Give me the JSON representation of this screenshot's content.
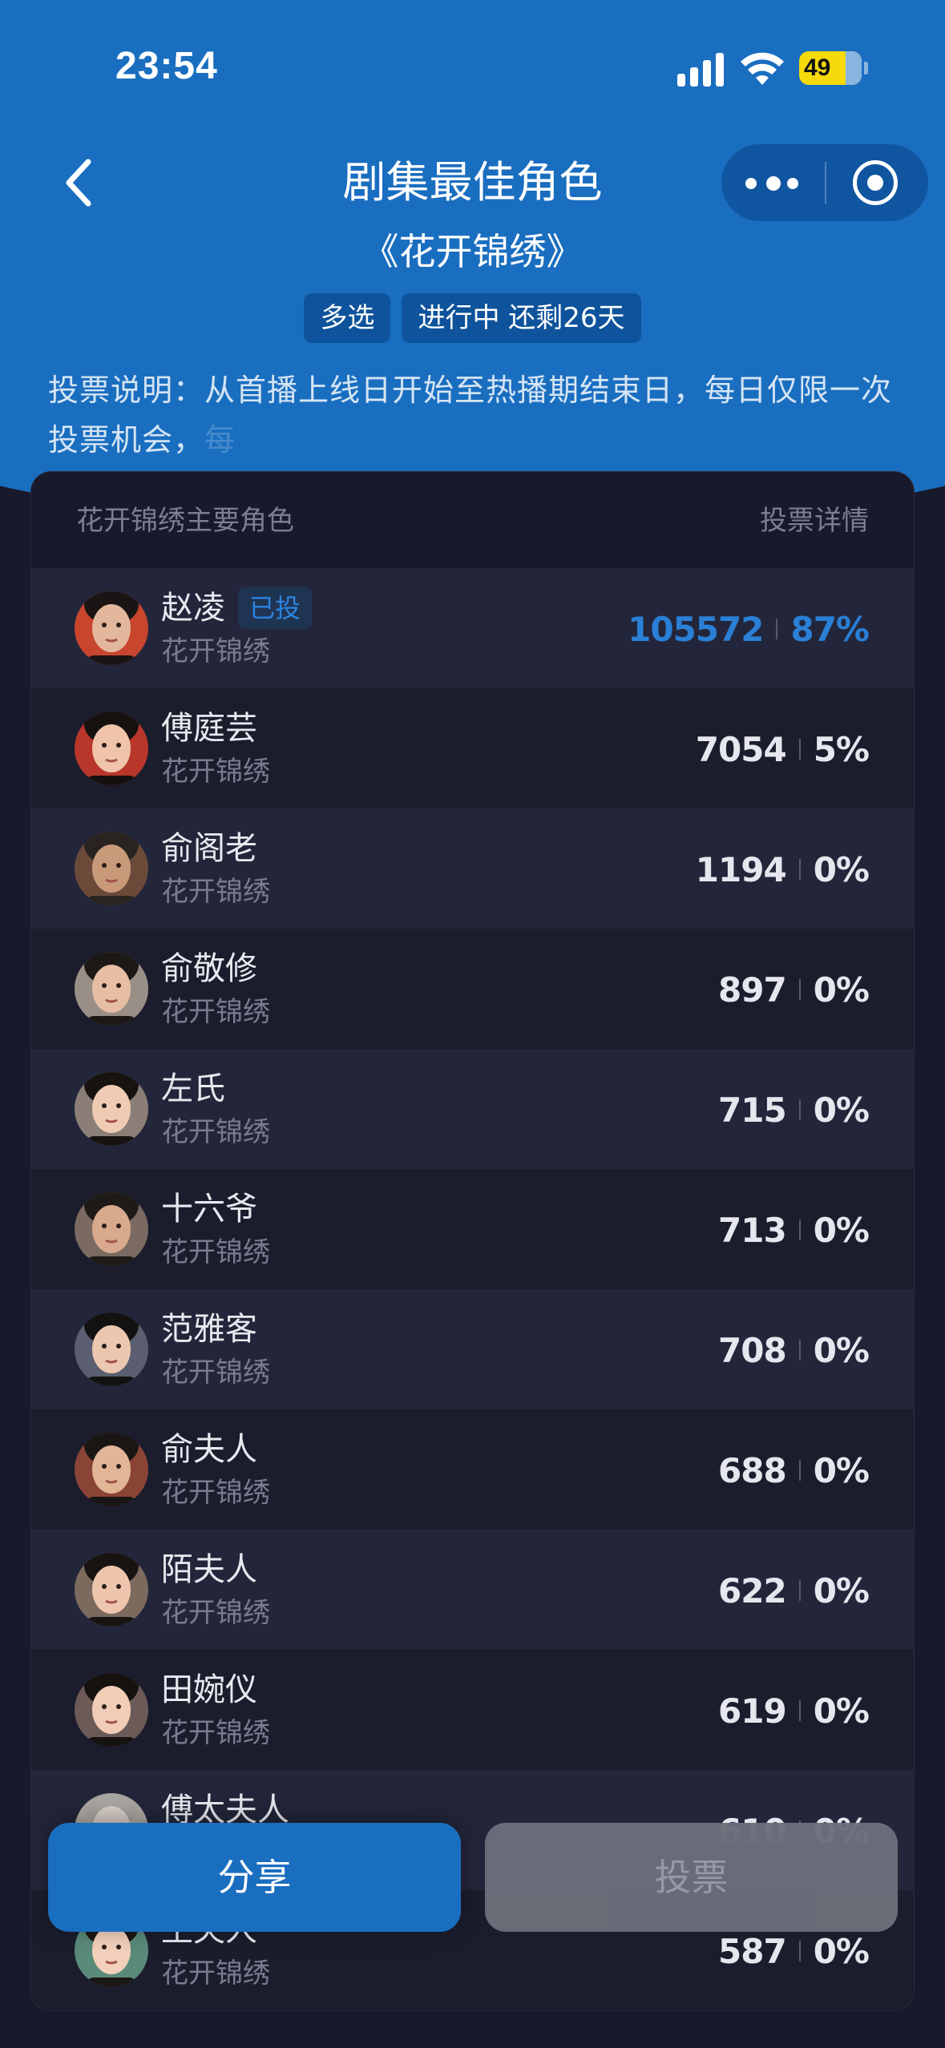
{
  "status_bar": {
    "time": "23:54",
    "battery": "49"
  },
  "nav": {
    "title": "剧集最佳角色"
  },
  "poll": {
    "show_title": "《花开锦绣》",
    "mode_badge": "多选",
    "status_badge": "进行中 还剩26天",
    "description": "投票说明：从首播上线日开始至热播期结束日，每日仅限一次投票机会，",
    "description_fade": "每"
  },
  "list": {
    "header_left": "花开锦绣主要角色",
    "header_right": "投票详情",
    "voted_label": "已投",
    "items": [
      {
        "name": "赵凌",
        "show": "花开锦绣",
        "count": "105572",
        "percent": "87%",
        "voted": true
      },
      {
        "name": "傅庭芸",
        "show": "花开锦绣",
        "count": "7054",
        "percent": "5%"
      },
      {
        "name": "俞阁老",
        "show": "花开锦绣",
        "count": "1194",
        "percent": "0%"
      },
      {
        "name": "俞敬修",
        "show": "花开锦绣",
        "count": "897",
        "percent": "0%"
      },
      {
        "name": "左氏",
        "show": "花开锦绣",
        "count": "715",
        "percent": "0%"
      },
      {
        "name": "十六爷",
        "show": "花开锦绣",
        "count": "713",
        "percent": "0%"
      },
      {
        "name": "范雅客",
        "show": "花开锦绣",
        "count": "708",
        "percent": "0%"
      },
      {
        "name": "俞夫人",
        "show": "花开锦绣",
        "count": "688",
        "percent": "0%"
      },
      {
        "name": "陌夫人",
        "show": "花开锦绣",
        "count": "622",
        "percent": "0%"
      },
      {
        "name": "田婉仪",
        "show": "花开锦绣",
        "count": "619",
        "percent": "0%"
      },
      {
        "name": "傅太夫人",
        "show": "花开锦绣",
        "count": "610",
        "percent": "0%"
      },
      {
        "name": "王夫人",
        "show": "花开锦绣",
        "count": "587",
        "percent": "0%"
      }
    ]
  },
  "actions": {
    "share_label": "分享",
    "vote_label": "投票"
  },
  "colors": {
    "accent": "#1a6ec0",
    "background": "#181a2b",
    "highlight": "#2a7fd6"
  }
}
